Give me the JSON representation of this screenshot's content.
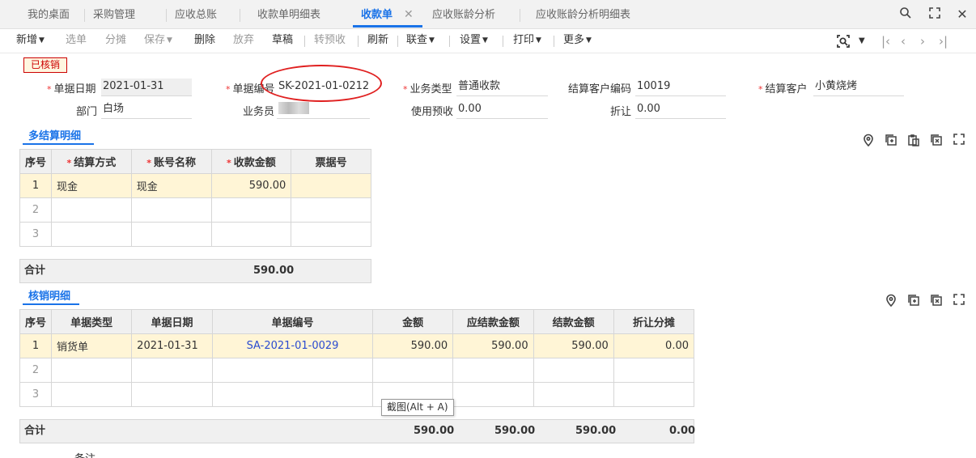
{
  "tabs": [
    "我的桌面",
    "采购管理",
    "应收总账",
    "收款单明细表",
    "收款单",
    "应收账龄分析",
    "应收账龄分析明细表"
  ],
  "toolbar": {
    "add": "新增",
    "select": "选单",
    "split": "分摊",
    "save": "保存",
    "delete": "删除",
    "abandon": "放弃",
    "draft": "草稿",
    "transfer": "转预收",
    "refresh": "刷新",
    "query": "联查",
    "settings": "设置",
    "print": "打印",
    "more": "更多"
  },
  "status_badge": "已核销",
  "form": {
    "date_label": "单据日期",
    "date_value": "2021-01-31",
    "no_label": "单据编号",
    "no_value": "SK-2021-01-0212",
    "biz_type_label": "业务类型",
    "biz_type_value": "普通收款",
    "cust_code_label": "结算客户编码",
    "cust_code_value": "10019",
    "cust_label": "结算客户",
    "cust_value": "小黄烧烤",
    "dept_label": "部门",
    "dept_value": "白场",
    "staff_label": "业务员",
    "prepay_label": "使用预收",
    "prepay_value": "0.00",
    "discount_label": "折让",
    "discount_value": "0.00"
  },
  "settlement": {
    "title": "多结算明细",
    "headers": [
      "序号",
      "结算方式",
      "账号名称",
      "收款金额",
      "票据号"
    ],
    "rows": [
      [
        "1",
        "现金",
        "现金",
        "590.00",
        ""
      ],
      [
        "2",
        "",
        "",
        "",
        ""
      ],
      [
        "3",
        "",
        "",
        "",
        ""
      ]
    ],
    "total_label": "合计",
    "total_amount": "590.00"
  },
  "writeoff": {
    "title": "核销明细",
    "headers": [
      "序号",
      "单据类型",
      "单据日期",
      "单据编号",
      "金额",
      "应结款金额",
      "结款金额",
      "折让分摊"
    ],
    "rows": [
      [
        "1",
        "销货单",
        "2021-01-31",
        "SA-2021-01-0029",
        "590.00",
        "590.00",
        "590.00",
        "0.00"
      ],
      [
        "2",
        "",
        "",
        "",
        "",
        "",
        "",
        ""
      ],
      [
        "3",
        "",
        "",
        "",
        "",
        "",
        "",
        ""
      ]
    ],
    "total_label": "合计",
    "totals": [
      "590.00",
      "590.00",
      "590.00",
      "0.00"
    ]
  },
  "tooltip": "截图(Alt + A)",
  "remark_label": "备注",
  "colors": {
    "accent": "#1a73e8",
    "badge_red": "#cc0000",
    "selected_row": "#fff5d6"
  }
}
